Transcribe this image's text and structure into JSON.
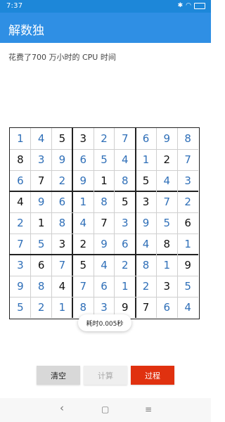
{
  "status_bar": {
    "time": "7:37",
    "icons": [
      "bluetooth-icon",
      "wifi-icon",
      "battery-icon"
    ]
  },
  "app_bar": {
    "title": "解数独"
  },
  "subtitle": "花费了700 万小时的 CPU 时间",
  "sudoku": {
    "rows": [
      [
        1,
        4,
        5,
        3,
        2,
        7,
        6,
        9,
        8
      ],
      [
        8,
        3,
        9,
        6,
        5,
        4,
        1,
        2,
        7
      ],
      [
        6,
        7,
        2,
        9,
        1,
        8,
        5,
        4,
        3
      ],
      [
        4,
        9,
        6,
        1,
        8,
        5,
        3,
        7,
        2
      ],
      [
        2,
        1,
        8,
        4,
        7,
        3,
        9,
        5,
        6
      ],
      [
        7,
        5,
        3,
        2,
        9,
        6,
        4,
        8,
        1
      ],
      [
        3,
        6,
        7,
        5,
        4,
        2,
        8,
        1,
        9
      ],
      [
        9,
        8,
        4,
        7,
        6,
        1,
        2,
        3,
        5
      ],
      [
        5,
        2,
        1,
        8,
        3,
        9,
        7,
        6,
        4
      ]
    ],
    "given": [
      [
        0,
        0,
        1,
        1,
        0,
        0,
        0,
        0,
        0
      ],
      [
        1,
        0,
        0,
        0,
        0,
        0,
        0,
        1,
        0
      ],
      [
        0,
        1,
        0,
        0,
        1,
        0,
        1,
        0,
        0
      ],
      [
        1,
        0,
        0,
        0,
        0,
        1,
        1,
        0,
        0
      ],
      [
        0,
        1,
        0,
        0,
        1,
        0,
        0,
        0,
        1
      ],
      [
        0,
        0,
        1,
        1,
        0,
        0,
        0,
        1,
        0
      ],
      [
        0,
        1,
        0,
        1,
        0,
        0,
        0,
        0,
        1
      ],
      [
        0,
        0,
        1,
        0,
        0,
        0,
        0,
        1,
        0
      ],
      [
        0,
        0,
        0,
        0,
        0,
        1,
        1,
        0,
        0
      ]
    ],
    "given_color": "#111111",
    "solved_color": "#2f6fb8"
  },
  "toast": {
    "text": "耗时0.005秒"
  },
  "buttons": {
    "clear": "清空",
    "calc": "计算",
    "process": "过程"
  },
  "colors": {
    "app_bar": "#2f8fe4",
    "status_bar": "#1d87d9",
    "process_button": "#e0310f"
  },
  "nav_bar": {
    "back": "‹",
    "home": "▢",
    "menu": "≡"
  }
}
